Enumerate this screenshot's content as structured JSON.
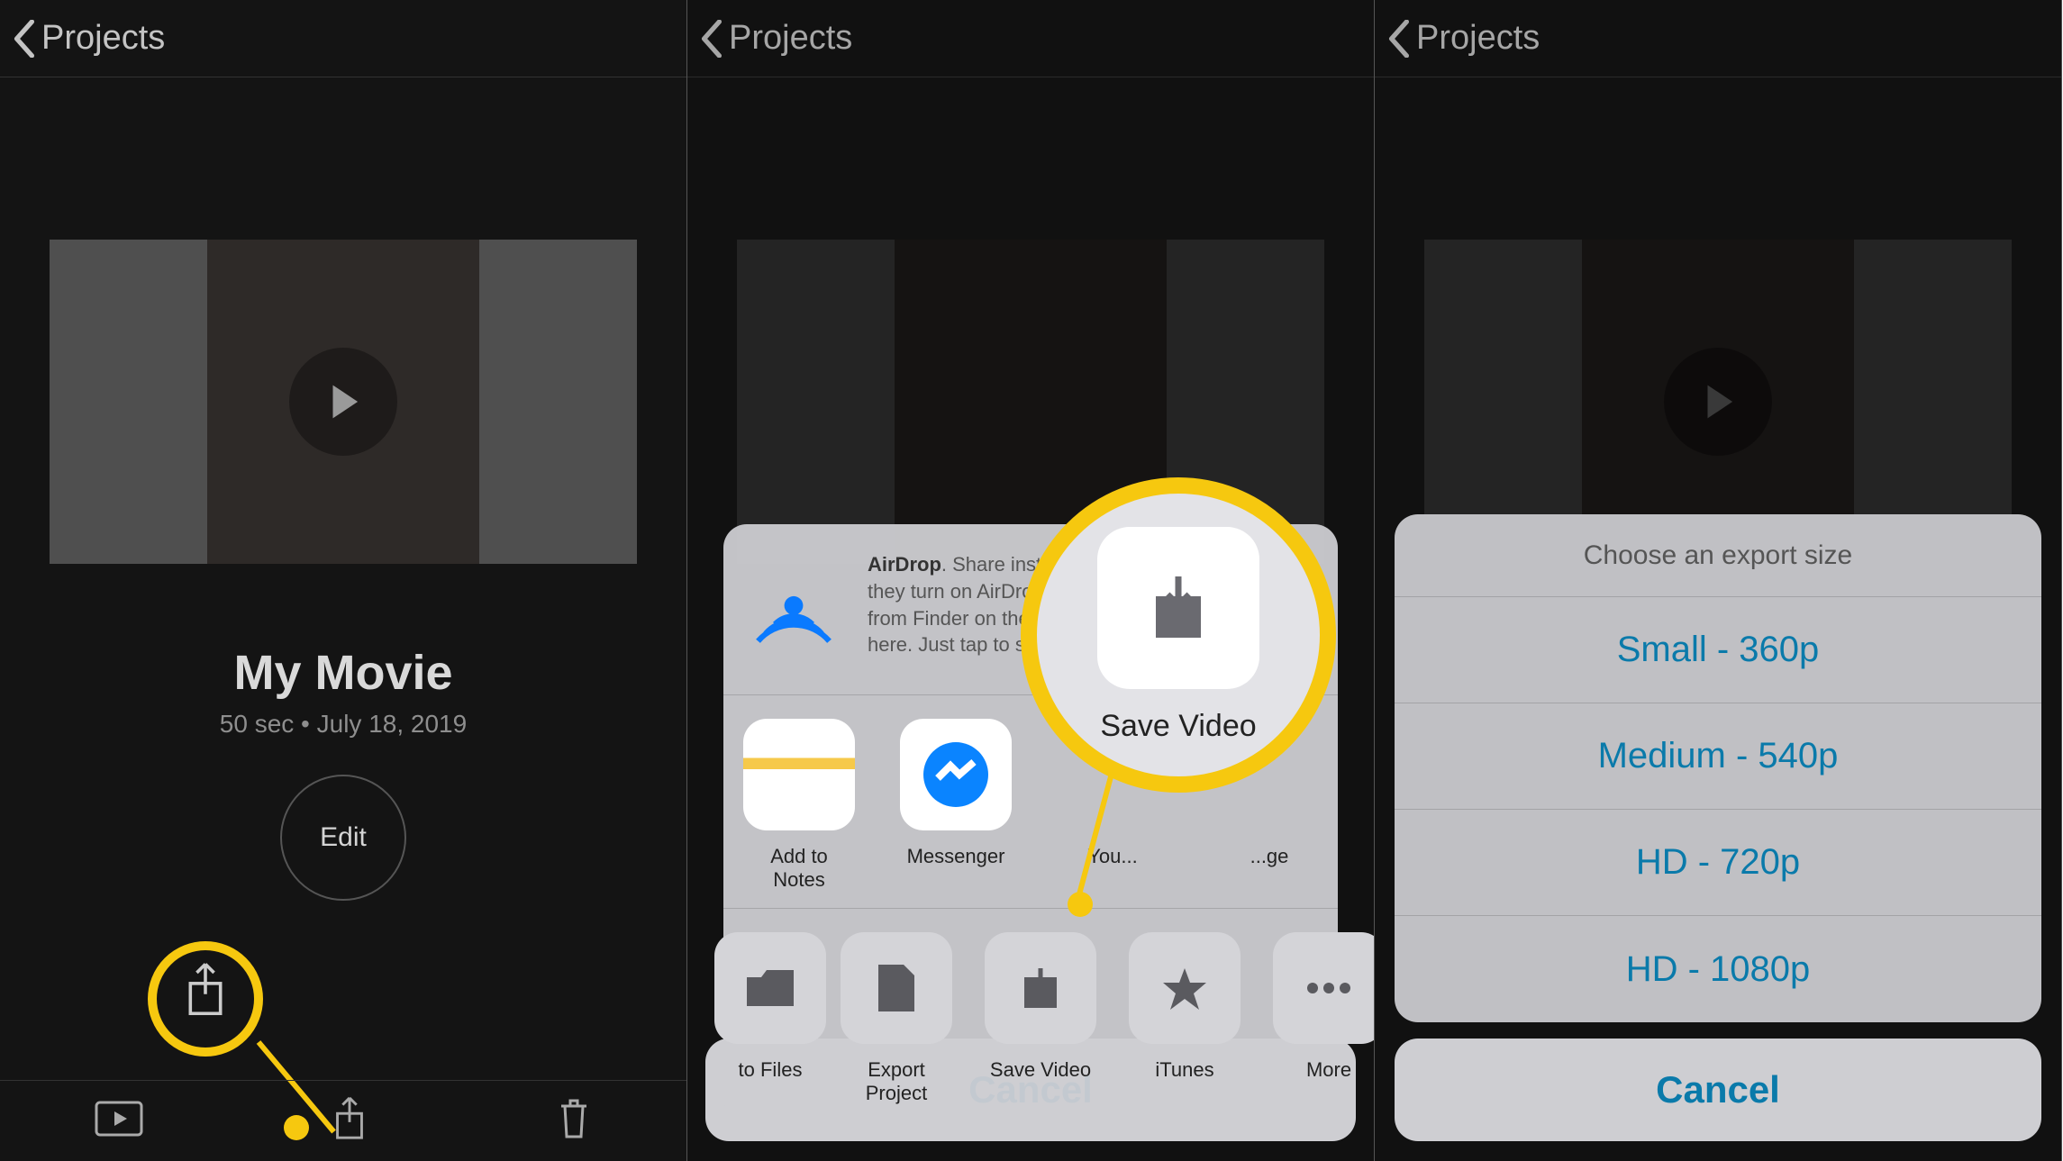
{
  "nav": {
    "back_label": "Projects"
  },
  "project": {
    "title": "My Movie",
    "meta": "50 sec • July 18, 2019",
    "edit_label": "Edit"
  },
  "share": {
    "airdrop_title": "AirDrop",
    "airdrop_text": ". Share instantly with people nearby. If they turn on AirDrop from Control Center on iOS or from Finder on the Mac, you'll see their names here. Just tap to share.",
    "apps": [
      {
        "name": "Add to Notes"
      },
      {
        "name": "Messenger"
      },
      {
        "name": "You..."
      },
      {
        "name": "...ge"
      }
    ],
    "actions": [
      {
        "name": "to Files"
      },
      {
        "name": "Export Project"
      },
      {
        "name": "Save Video"
      },
      {
        "name": "iTunes"
      },
      {
        "name": "More"
      }
    ],
    "cancel": "Cancel",
    "magnified_label": "Save Video"
  },
  "export": {
    "header": "Choose an export size",
    "options": [
      "Small - 360p",
      "Medium - 540p",
      "HD - 720p",
      "HD - 1080p"
    ],
    "cancel": "Cancel"
  }
}
